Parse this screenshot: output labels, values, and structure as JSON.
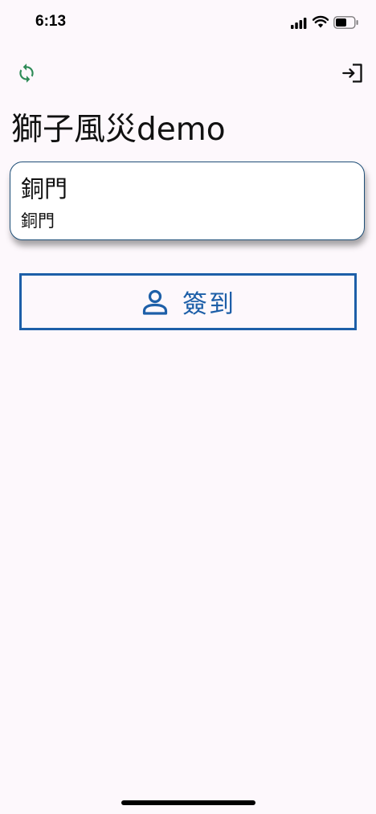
{
  "status_bar": {
    "time": "6:13"
  },
  "toolbar": {
    "refresh_icon": "refresh-icon",
    "logout_icon": "login-icon"
  },
  "page": {
    "title": "獅子風災demo"
  },
  "location_card": {
    "title": "銅門",
    "subtitle": "銅門"
  },
  "checkin_button": {
    "label": "簽到",
    "icon": "person-icon"
  },
  "colors": {
    "background": "#fdf8fc",
    "accent": "#1d5fa8",
    "card_border": "#1e4f78",
    "refresh_icon": "#2e8b57"
  }
}
